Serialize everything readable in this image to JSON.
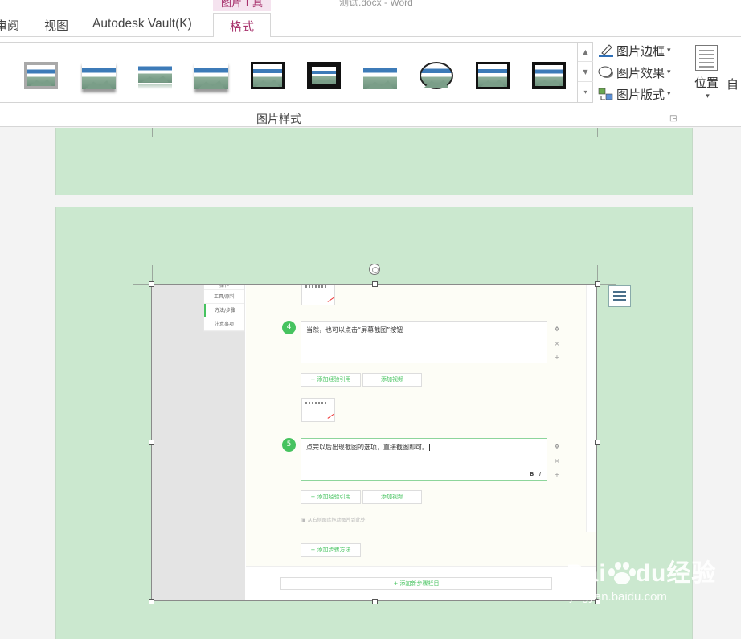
{
  "window": {
    "context_tab_group": "图片工具",
    "doc_title": "测试.docx - Word"
  },
  "tabs": [
    {
      "label": "审阅"
    },
    {
      "label": "视图"
    },
    {
      "label": "Autodesk Vault(K)"
    },
    {
      "label": "格式",
      "active": true
    }
  ],
  "ribbon": {
    "picture_styles_group": "图片样式",
    "gallery_scroll": [
      "▲",
      "▼",
      "▾"
    ],
    "border_cmd": "图片边框",
    "effects_cmd": "图片效果",
    "layout_cmd": "图片版式",
    "position_btn": "位置",
    "wrap_btn": "自",
    "caret": "▾"
  },
  "embedded_screenshot": {
    "nav_items": [
      "操作",
      "工具/原料",
      "方法/步骤",
      "注意事项"
    ],
    "step4": {
      "number": "4",
      "text": "当然，也可以点击“屏幕截图”按钮"
    },
    "step5": {
      "number": "5",
      "text": "点完以后出现截图的选项，直接截图即可。"
    },
    "side_controls": [
      "✥",
      "×",
      "+"
    ],
    "add_quote_btn": "+ 添加经验引用",
    "add_video_btn": "添加视频",
    "bold_label": "B",
    "italic_label": "I",
    "drag_hint": "从右侧图库拖动图片到此处",
    "add_method_btn": "+ 添加步骤方法",
    "add_column_btn": "+ 添加新步骤栏目"
  },
  "watermark": {
    "brand_left": "Bai",
    "brand_right": "经验",
    "url": "jingyan.baidu.com"
  },
  "colors": {
    "page_bg": "#cbe8cf",
    "accent_tab": "#a8336d",
    "step_green": "#46c35f"
  }
}
